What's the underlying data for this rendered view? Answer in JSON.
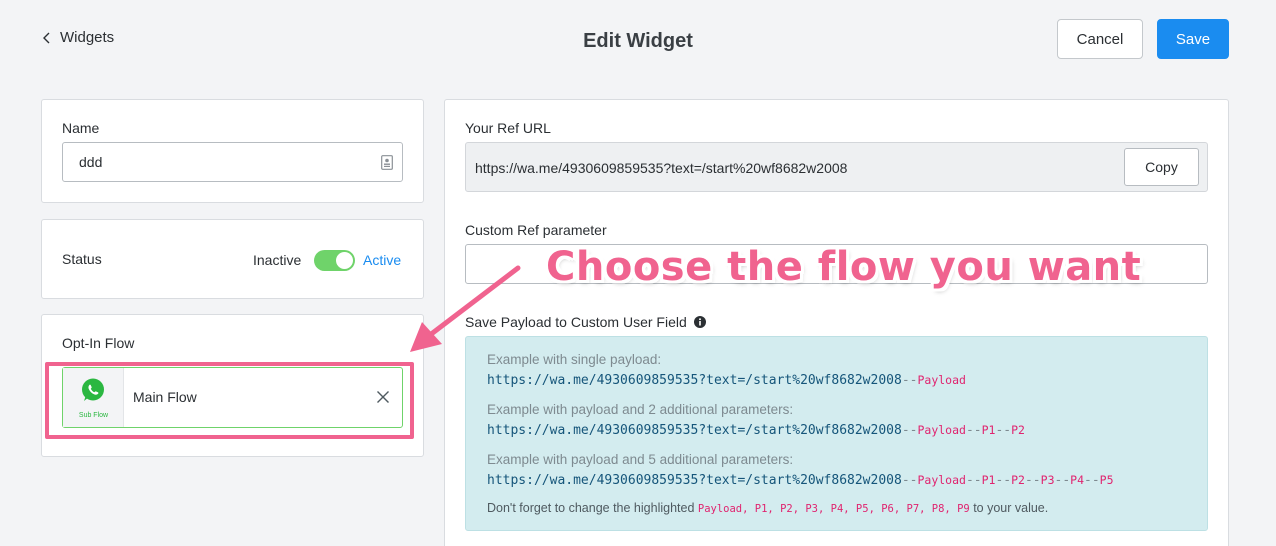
{
  "header": {
    "back_label": "Widgets",
    "title": "Edit Widget",
    "cancel_label": "Cancel",
    "save_label": "Save"
  },
  "name_card": {
    "label": "Name",
    "value": "ddd"
  },
  "status_card": {
    "label": "Status",
    "inactive_label": "Inactive",
    "active_label": "Active",
    "toggle_on": true
  },
  "optin_card": {
    "label": "Opt-In Flow",
    "flow": {
      "thumb_label": "Sub Flow",
      "name": "Main Flow",
      "icon": "whatsapp-icon"
    }
  },
  "ref_url": {
    "label": "Your Ref URL",
    "value": "https://wa.me/4930609859535?text=/start%20wf8682w2008",
    "copy_label": "Copy"
  },
  "custom_ref": {
    "label": "Custom Ref parameter",
    "value": ""
  },
  "payload": {
    "label": "Save Payload to Custom User Field",
    "examples": [
      {
        "label": "Example with single payload:",
        "base": "https://wa.me/4930609859535?text=/start%20wf8682w2008",
        "params": [
          "Payload"
        ]
      },
      {
        "label": "Example with payload and 2 additional parameters:",
        "base": "https://wa.me/4930609859535?text=/start%20wf8682w2008",
        "params": [
          "Payload",
          "P1",
          "P2"
        ]
      },
      {
        "label": "Example with payload and 5 additional parameters:",
        "base": "https://wa.me/4930609859535?text=/start%20wf8682w2008",
        "params": [
          "Payload",
          "P1",
          "P2",
          "P3",
          "P4",
          "P5"
        ]
      }
    ],
    "note_prefix": "Don't forget to change the highlighted ",
    "note_highlight": "Payload",
    "note_params": ", P1, P2, P3, P4, P5, P6, P7, P8, P9",
    "note_suffix": " to your value."
  },
  "annotation": {
    "text": "Choose the flow you want",
    "color": "#f0638f"
  },
  "colors": {
    "accent": "#1a8cf0",
    "toggle_green": "#6fd36a",
    "highlight_pink": "#f0638f",
    "payload_bg": "#d3ecef"
  }
}
